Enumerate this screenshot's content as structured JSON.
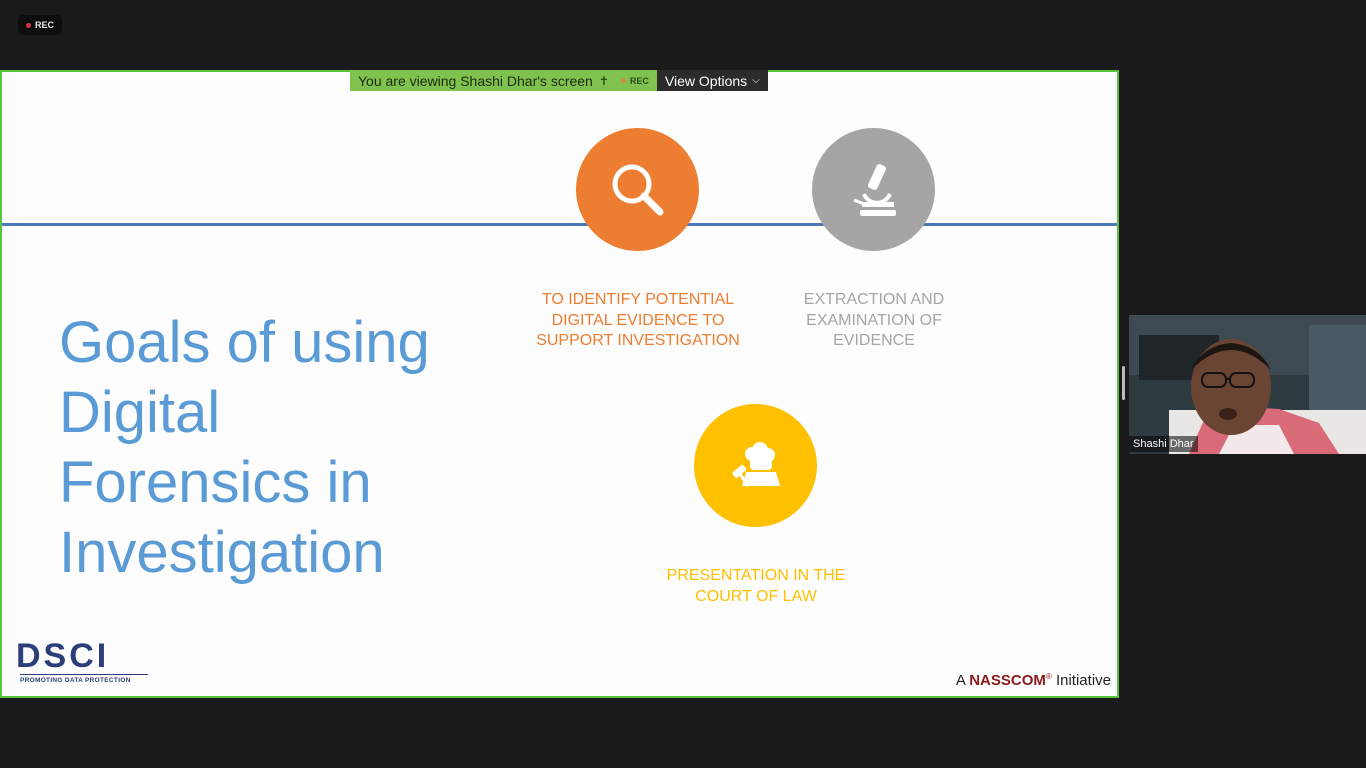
{
  "recording": {
    "label": "REC"
  },
  "share_bar": {
    "viewing_text": "You are viewing Shashi Dhar's screen",
    "rec_label": "REC",
    "view_options_label": "View Options",
    "pin_icon": "pin-icon",
    "chevron_icon": "chevron-down-icon"
  },
  "slide": {
    "title": "Goals of using Digital Forensics in Investigation",
    "goals": [
      {
        "text": "TO IDENTIFY POTENTIAL DIGITAL EVIDENCE TO SUPPORT INVESTIGATION",
        "color": "#ED7D31",
        "icon": "magnifier-icon"
      },
      {
        "text": "EXTRACTION AND EXAMINATION OF EVIDENCE",
        "color": "#A5A5A5",
        "icon": "microscope-icon"
      },
      {
        "text": "PRESENTATION IN THE COURT OF LAW",
        "color": "#FFC000",
        "icon": "gavel-icon"
      }
    ],
    "logo": {
      "word": "DSCI",
      "tagline": "PROMOTING DATA PROTECTION"
    },
    "footer": {
      "prefix": "A",
      "brand": "NASSCOM",
      "reg": "®",
      "suffix": "Initiative"
    },
    "accent_line_color": "#4A78B8",
    "title_color": "#5B9BD5"
  },
  "participant": {
    "name": "Shashi Dhar"
  },
  "colors": {
    "share_border": "#57C43B",
    "share_bar_bg": "#7FC24D",
    "view_options_bg": "#2B2B2B",
    "background": "#1A1A1A"
  }
}
